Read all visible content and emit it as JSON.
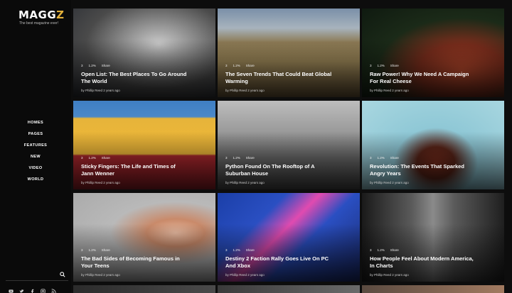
{
  "brand": {
    "name_main": "MAGG",
    "name_accent": "Z",
    "tagline": "The best magazine ever!"
  },
  "nav": [
    "HOMES",
    "PAGES",
    "FEATURES",
    "NEW",
    "VIDEO",
    "WORLD"
  ],
  "social_icons": [
    "youtube-icon",
    "twitter-icon",
    "facebook-icon",
    "instagram-icon",
    "rss-icon"
  ],
  "posts": [
    {
      "title": "Open List: The Best Places To Go Around The World",
      "meta": [
        "3",
        "1.2%",
        "Share"
      ],
      "byline": "by Phillip Reed 2 years ago"
    },
    {
      "title": "The Seven Trends That Could Beat Global Warming",
      "meta": [
        "3",
        "1.2%",
        "Share"
      ],
      "byline": "by Phillip Reed 2 years ago"
    },
    {
      "title": "Raw Power! Why We Need A Campaign For Real Cheese",
      "meta": [
        "3",
        "1.2%",
        "Share"
      ],
      "byline": "by Phillip Reed 2 years ago"
    },
    {
      "title": "Sticky Fingers: The Life and Times of Jann Wenner",
      "meta": [
        "3",
        "1.2%",
        "Share"
      ],
      "byline": "by Phillip Reed 2 years ago"
    },
    {
      "title": "Python Found On The Rooftop of A Suburban House",
      "meta": [
        "3",
        "1.2%",
        "Share"
      ],
      "byline": "by Phillip Reed 2 years ago"
    },
    {
      "title": "Revolution: The Events That Sparked Angry Years",
      "meta": [
        "3",
        "1.2%",
        "Share"
      ],
      "byline": "by Phillip Reed 2 years ago"
    },
    {
      "title": "The Bad Sides of Becoming Famous in Your Teens",
      "meta": [
        "3",
        "1.2%",
        "Share"
      ],
      "byline": "by Phillip Reed 2 years ago"
    },
    {
      "title": "Destiny 2 Faction Rally Goes Live On PC And Xbox",
      "meta": [
        "3",
        "1.2%",
        "Share"
      ],
      "byline": "by Phillip Reed 2 years ago"
    },
    {
      "title": "How People Feel About Modern America, In Charts",
      "meta": [
        "3",
        "1.2%",
        "Share"
      ],
      "byline": "by Phillip Reed 2 years ago"
    }
  ]
}
